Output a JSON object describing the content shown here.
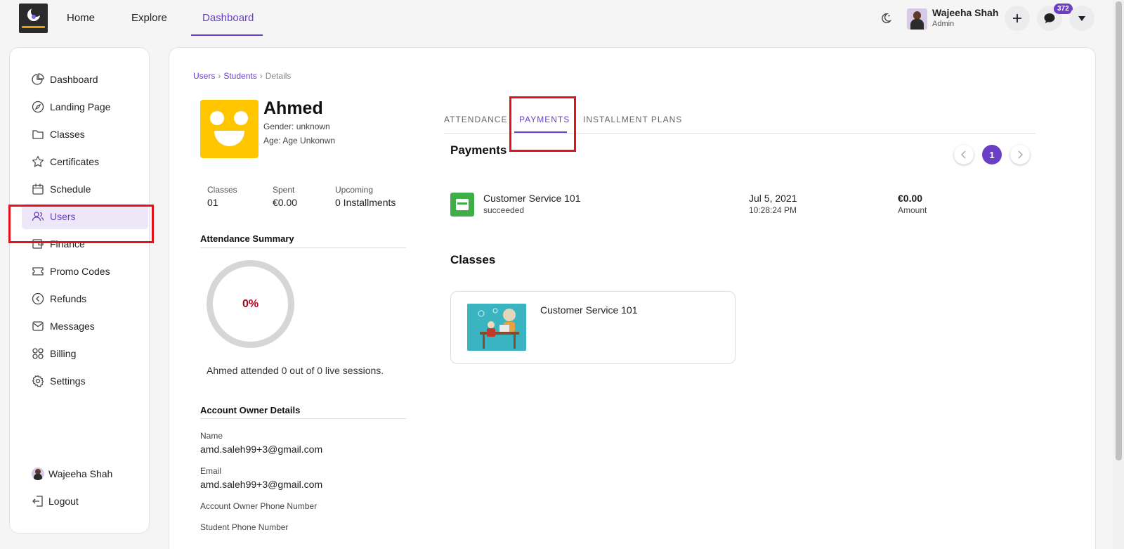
{
  "topnav": {
    "links": [
      "Home",
      "Explore",
      "Dashboard"
    ],
    "active": "Dashboard",
    "user_name": "Wajeeha Shah",
    "user_role": "Admin",
    "notification_count": "372"
  },
  "sidebar": {
    "items": [
      {
        "label": "Dashboard",
        "icon": "pie-chart-icon"
      },
      {
        "label": "Landing Page",
        "icon": "compass-icon"
      },
      {
        "label": "Classes",
        "icon": "folder-icon"
      },
      {
        "label": "Certificates",
        "icon": "star-icon"
      },
      {
        "label": "Schedule",
        "icon": "calendar-icon"
      },
      {
        "label": "Users",
        "icon": "users-icon"
      },
      {
        "label": "Finance",
        "icon": "wallet-icon"
      },
      {
        "label": "Promo Codes",
        "icon": "ticket-icon"
      },
      {
        "label": "Refunds",
        "icon": "arrow-circle-left-icon"
      },
      {
        "label": "Messages",
        "icon": "envelope-icon"
      },
      {
        "label": "Billing",
        "icon": "grid-icon"
      },
      {
        "label": "Settings",
        "icon": "gear-icon"
      }
    ],
    "active": "Users",
    "footer_user": "Wajeeha Shah",
    "logout": "Logout"
  },
  "breadcrumb": {
    "items": [
      "Users",
      "Students",
      "Details"
    ]
  },
  "student": {
    "name": "Ahmed",
    "gender": "Gender: unknown",
    "age": "Age: Age Unkonwn"
  },
  "stats": [
    {
      "label": "Classes",
      "value": "01"
    },
    {
      "label": "Spent",
      "value": "€0.00"
    },
    {
      "label": "Upcoming",
      "value": "0 Installments"
    }
  ],
  "attendance": {
    "title": "Attendance Summary",
    "percent_label": "0%",
    "percent": 0,
    "summary": "Ahmed attended 0 out of 0 live sessions."
  },
  "account_owner": {
    "title": "Account Owner Details",
    "name_label": "Name",
    "name_value": "amd.saleh99+3@gmail.com",
    "email_label": "Email",
    "email_value": "amd.saleh99+3@gmail.com",
    "owner_phone_label": "Account Owner Phone Number",
    "student_phone_label": "Student Phone Number"
  },
  "tabs": {
    "items": [
      "ATTENDANCE",
      "PAYMENTS",
      "INSTALLMENT PLANS"
    ],
    "active": "PAYMENTS"
  },
  "payments": {
    "title": "Payments",
    "page": "1",
    "rows": [
      {
        "class": "Customer Service 101",
        "status": "succeeded",
        "date": "Jul 5, 2021",
        "time": "10:28:24 PM",
        "amount": "€0.00",
        "amount_label": "Amount"
      }
    ]
  },
  "classes": {
    "title": "Classes",
    "items": [
      {
        "title": "Customer Service 101"
      }
    ]
  },
  "colors": {
    "accent": "#6a3fc5",
    "highlight": "#e0141c",
    "avatar_yellow": "#ffc600",
    "payment_green": "#3fae49",
    "percent_red": "#b00020"
  }
}
